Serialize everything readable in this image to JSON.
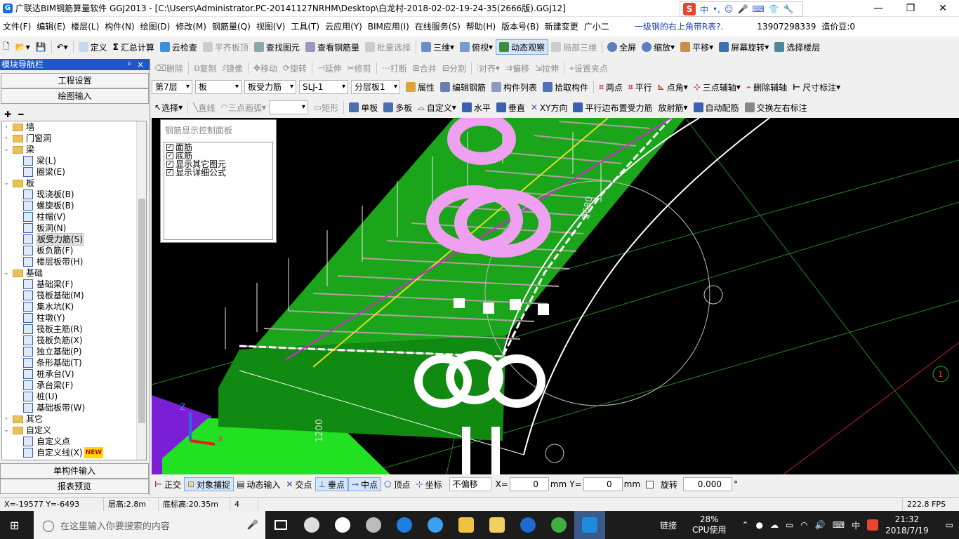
{
  "window": {
    "title": "广联达BIM钢筋算量软件 GGJ2013 - [C:\\Users\\Administrator.PC-20141127NRHM\\Desktop\\白龙村-2018-02-02-19-24-35(2666版).GGJ12]",
    "ime": {
      "mode": "中",
      "punct": "•,"
    }
  },
  "menu": {
    "items": [
      "文件(F)",
      "编辑(E)",
      "楼层(L)",
      "构件(N)",
      "绘图(D)",
      "修改(M)",
      "钢筋量(Q)",
      "视图(V)",
      "工具(T)",
      "云应用(Y)",
      "BIM应用(I)",
      "在线服务(S)",
      "帮助(H)",
      "版本号(B)",
      "新建变更",
      "广小二"
    ],
    "hint": "一级钢的右上角带R表?.",
    "phone": "13907298339",
    "beans": "造价豆:0"
  },
  "toolbar1": {
    "items": [
      "定义",
      "汇总计算",
      "云检查",
      "平齐板顶",
      "查找图元",
      "查看钢筋量",
      "批量选择",
      "三维",
      "俯视",
      "动态观察",
      "局部三维",
      "全屏",
      "缩放",
      "平移",
      "屏幕旋转",
      "选择楼层"
    ]
  },
  "toolbar2": {
    "items": [
      "删除",
      "复制",
      "镜像",
      "移动",
      "旋转",
      "延伸",
      "修剪",
      "打断",
      "合并",
      "分割",
      "对齐",
      "偏移",
      "拉伸",
      "设置夹点"
    ]
  },
  "toolbar3": {
    "floor": "第7层",
    "component_type": "板",
    "sub_type": "板受力筋",
    "component": "SLJ-1",
    "layer": "分层板1",
    "items": [
      "属性",
      "编辑钢筋",
      "构件列表",
      "拾取构件",
      "两点",
      "平行",
      "点角",
      "三点辅轴",
      "删除辅轴",
      "尺寸标注"
    ]
  },
  "toolbar4": {
    "items": [
      "选择",
      "直线",
      "三点画弧",
      "",
      "矩形",
      "单板",
      "多板",
      "自定义",
      "水平",
      "垂直",
      "XY方向",
      "平行边布置受力筋",
      "放射筋",
      "自动配筋",
      "交换左右标注"
    ]
  },
  "sidebar": {
    "title": "模块导航栏",
    "pin": "ᵖ",
    "close": "×",
    "tab_settings": "工程设置",
    "tab_draw": "绘图输入",
    "tree": [
      {
        "type": "folder",
        "exp": "›",
        "label": "墙"
      },
      {
        "type": "folder",
        "exp": "›",
        "label": "门窗洞"
      },
      {
        "type": "folder",
        "exp": "⌄",
        "label": "梁"
      },
      {
        "type": "item",
        "label": "梁(L)"
      },
      {
        "type": "item",
        "label": "圈梁(E)"
      },
      {
        "type": "folder",
        "exp": "⌄",
        "label": "板"
      },
      {
        "type": "item",
        "label": "现浇板(B)"
      },
      {
        "type": "item",
        "label": "螺旋板(B)"
      },
      {
        "type": "item",
        "label": "柱帽(V)"
      },
      {
        "type": "item",
        "label": "板洞(N)"
      },
      {
        "type": "item",
        "label": "板受力筋(S)",
        "selected": true
      },
      {
        "type": "item",
        "label": "板负筋(F)"
      },
      {
        "type": "item",
        "label": "楼层板带(H)"
      },
      {
        "type": "folder",
        "exp": "⌄",
        "label": "基础"
      },
      {
        "type": "item",
        "label": "基础梁(F)"
      },
      {
        "type": "item",
        "label": "筏板基础(M)"
      },
      {
        "type": "item",
        "label": "集水坑(K)"
      },
      {
        "type": "item",
        "label": "柱墩(Y)"
      },
      {
        "type": "item",
        "label": "筏板主筋(R)"
      },
      {
        "type": "item",
        "label": "筏板负筋(X)"
      },
      {
        "type": "item",
        "label": "独立基础(P)"
      },
      {
        "type": "item",
        "label": "条形基础(T)"
      },
      {
        "type": "item",
        "label": "桩承台(V)"
      },
      {
        "type": "item",
        "label": "承台梁(F)"
      },
      {
        "type": "item",
        "label": "桩(U)"
      },
      {
        "type": "item",
        "label": "基础板带(W)"
      },
      {
        "type": "folder",
        "exp": "›",
        "label": "其它"
      },
      {
        "type": "folder",
        "exp": "⌄",
        "label": "自定义"
      },
      {
        "type": "item",
        "label": "自定义点"
      },
      {
        "type": "item",
        "label": "自定义线(X)",
        "new": "NEW"
      }
    ],
    "tab_single": "单构件输入",
    "tab_report": "报表预览"
  },
  "rebar_panel": {
    "title": "钢筋显示控制面板",
    "options": [
      "面筋",
      "底筋",
      "显示其它图元",
      "显示详细公式"
    ]
  },
  "viewport": {
    "dim_top": "2680",
    "dim_left": "1200",
    "axis_label": "1",
    "axis_z": "Z",
    "axis_x": "X"
  },
  "snapbar": {
    "items": [
      "正交",
      "对象捕捉",
      "动态输入",
      "交点",
      "垂点",
      "中点",
      "顶点",
      "坐标"
    ],
    "offset_mode": "不偏移",
    "x_label": "X=",
    "x_value": "0",
    "y_label": "Y=",
    "y_value": "0",
    "unit": "mm",
    "rotate_label": "旋转",
    "rotate_value": "0.000",
    "degree": "°"
  },
  "statusbar": {
    "coords": "X=-19577  Y=-6493",
    "floor_height": "层高:2.8m",
    "base_height": "底标高:20.35m",
    "count": "4",
    "fps": "222.8 FPS"
  },
  "taskbar": {
    "search_placeholder": "在这里输入你要搜索的内容",
    "link": "链接",
    "cpu_percent": "28%",
    "cpu_label": "CPU使用",
    "lang": "中",
    "time": "21:32",
    "date": "2018/7/19"
  }
}
